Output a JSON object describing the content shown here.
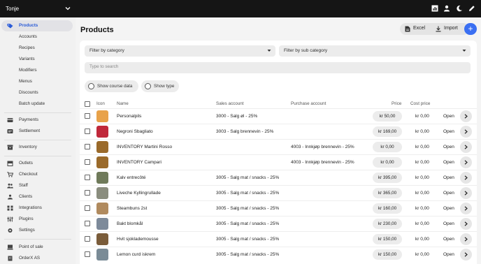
{
  "topbar": {
    "user": "Tonje",
    "icons": [
      "chevron-down-icon",
      "chart-icon",
      "user-icon",
      "moon-icon",
      "pencil-icon"
    ]
  },
  "sidebar": {
    "items": [
      {
        "label": "Products",
        "icon": "tag-icon",
        "active": true
      },
      {
        "label": "Accounts"
      },
      {
        "label": "Recipes"
      },
      {
        "label": "Variants"
      },
      {
        "label": "Modifiers"
      },
      {
        "label": "Menus"
      },
      {
        "label": "Discounts"
      },
      {
        "label": "Batch update"
      },
      {
        "label": "Payments",
        "icon": "card-icon"
      },
      {
        "label": "Settlement",
        "icon": "receipt-icon"
      },
      {
        "label": "Inventory",
        "icon": "box-icon"
      },
      {
        "label": "Outlets",
        "icon": "store-icon"
      },
      {
        "label": "Checkout",
        "icon": "cart-icon"
      },
      {
        "label": "Staff",
        "icon": "people-icon"
      },
      {
        "label": "Clients",
        "icon": "clients-icon"
      },
      {
        "label": "Integrations",
        "icon": "plug-icon"
      },
      {
        "label": "Plugins",
        "icon": "sliders-icon"
      },
      {
        "label": "Settings",
        "icon": "gear-icon"
      },
      {
        "label": "Point of sale",
        "icon": "pos-icon"
      },
      {
        "label": "OrderX AS",
        "icon": "building-icon"
      }
    ]
  },
  "page": {
    "title": "Products",
    "excel_label": "Excel",
    "import_label": "Import",
    "add_label": "+"
  },
  "filters": {
    "category": "Filter by category",
    "sub_category": "Filter by sub category",
    "search_placeholder": "Type to search",
    "show_course_data": "Show course data",
    "show_type": "Show type"
  },
  "table": {
    "headers": {
      "icon": "Icon",
      "name": "Name",
      "sales_account": "Sales account",
      "purchase_account": "Purchase account",
      "price": "Price",
      "cost_price": "Cost price"
    },
    "open_label": "Open",
    "rows": [
      {
        "name": "Personalpils",
        "sales": "3000 - Salg øl - 25%",
        "purchase": "",
        "price": "kr 50,00",
        "cost": "kr 0,00",
        "thumb": "#e8a24a"
      },
      {
        "name": "Negroni Sbagliato",
        "sales": "3003 - Salg brennevin - 25%",
        "purchase": "",
        "price": "kr 169,00",
        "cost": "kr 0,00",
        "thumb": "#c0283a"
      },
      {
        "name": "INVENTORY Martini Rosso",
        "sales": "",
        "purchase": "4003 - Innkjøp brennevin - 25%",
        "price": "kr 0,00",
        "cost": "kr 0,00",
        "thumb": "#9a6a2a"
      },
      {
        "name": "INVENTORY Campari",
        "sales": "",
        "purchase": "4003 - Innkjøp brennevin - 25%",
        "price": "kr 0,00",
        "cost": "kr 0,00",
        "thumb": "#9a6a2a"
      },
      {
        "name": "Kalv entrecôté",
        "sales": "3005 - Salg mat / snacks - 25%",
        "purchase": "",
        "price": "kr 395,00",
        "cost": "kr 0,00",
        "thumb": "#6f7a5a"
      },
      {
        "name": "Liveche Kyllingrullade",
        "sales": "3005 - Salg mat / snacks - 25%",
        "purchase": "",
        "price": "kr 365,00",
        "cost": "kr 0,00",
        "thumb": "#8a8d7e"
      },
      {
        "name": "Steambuns 2st",
        "sales": "3005 - Salg mat / snacks - 25%",
        "purchase": "",
        "price": "kr 160,00",
        "cost": "kr 0,00",
        "thumb": "#b08a5e"
      },
      {
        "name": "Bakt blomkål",
        "sales": "3005 - Salg mat / snacks - 25%",
        "purchase": "",
        "price": "kr 230,00",
        "cost": "kr 0,00",
        "thumb": "#7d8a9a"
      },
      {
        "name": "Hvit sjoklademousse",
        "sales": "3005 - Salg mat / snacks - 25%",
        "purchase": "",
        "price": "kr 150,00",
        "cost": "kr 0,00",
        "thumb": "#7a5c3a"
      },
      {
        "name": "Lemon curd iskrem",
        "sales": "3005 - Salg mat / snacks - 25%",
        "purchase": "",
        "price": "kr 150,00",
        "cost": "kr 0,00",
        "thumb": "#7a8b96"
      }
    ]
  }
}
